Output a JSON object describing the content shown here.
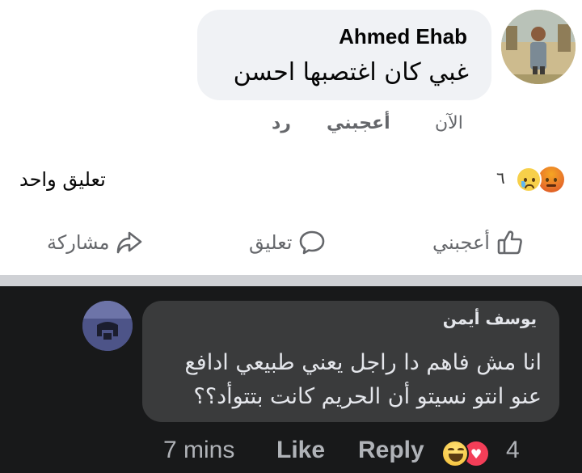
{
  "top_comment": {
    "author": "Ahmed Ehab",
    "text": "غبي كان اغتصبها احسن",
    "time": "الآن",
    "like_label": "أعجبني",
    "reply_label": "رد"
  },
  "post_stats": {
    "reaction_count": "٦",
    "reactions": [
      "sad-icon",
      "angry-icon"
    ],
    "comments_label": "تعليق واحد"
  },
  "post_actions": {
    "like": "أعجبني",
    "comment": "تعليق",
    "share": "مشاركة"
  },
  "reply_comment": {
    "author": "يوسف أيمن",
    "text": "انا مش فاهم دا راجل يعني طبيعي ادافع عنو انتو نسيتو أن الحريم كانت بتتوأد؟؟",
    "time": "7 mins",
    "like_label": "Like",
    "reply_label": "Reply",
    "reactions": [
      "haha-icon",
      "love-icon"
    ],
    "reaction_count": "4"
  },
  "colors": {
    "dark_bg": "#18191a",
    "dark_bubble": "#3a3b3c",
    "light_bubble": "#f0f2f5",
    "meta_gray": "#65676b"
  }
}
